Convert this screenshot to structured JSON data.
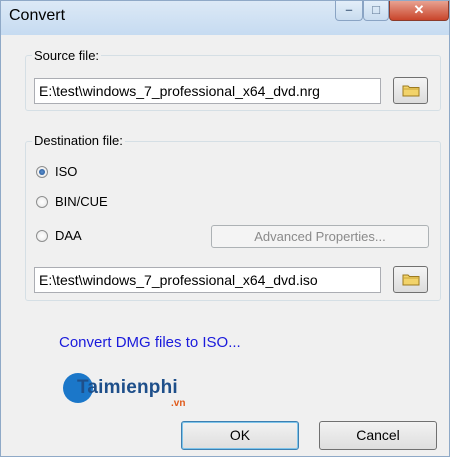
{
  "window": {
    "title": "Convert"
  },
  "source": {
    "label": "Source file:",
    "path": "E:\\test\\windows_7_professional_x64_dvd.nrg"
  },
  "destination": {
    "label": "Destination file:",
    "options": [
      {
        "label": "ISO",
        "checked": true
      },
      {
        "label": "BIN/CUE",
        "checked": false
      },
      {
        "label": "DAA",
        "checked": false
      }
    ],
    "advanced_label": "Advanced Properties...",
    "path": "E:\\test\\windows_7_professional_x64_dvd.iso"
  },
  "link": {
    "text": "Convert DMG files to ISO..."
  },
  "watermark": {
    "brand": "Taimienphi",
    "suffix": ".vn"
  },
  "buttons": {
    "ok": "OK",
    "cancel": "Cancel"
  },
  "colors": {
    "link": "#1a1adc",
    "close": "#c9452b",
    "titlebar": "#c6dbf1"
  }
}
